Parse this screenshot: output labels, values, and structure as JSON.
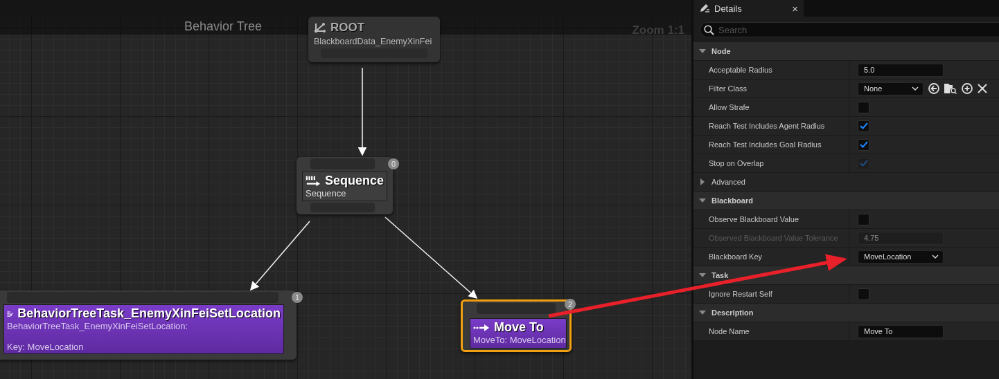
{
  "graph": {
    "title": "Behavior Tree",
    "zoom": "Zoom 1:1",
    "nodes": [
      {
        "kind": "root",
        "title": "ROOT",
        "subtitle": "BlackboardData_EnemyXinFei"
      },
      {
        "kind": "composite",
        "title": "Sequence",
        "subtitle": "Sequence",
        "index": "0",
        "selected": false
      },
      {
        "kind": "task",
        "title": "BehaviorTreeTask_EnemyXinFeiSetLocation",
        "subtitle": "BehaviorTreeTask_EnemyXinFeiSetLocation:\n\nKey: MoveLocation",
        "index": "1",
        "selected": false
      },
      {
        "kind": "task",
        "title": "Move To",
        "subtitle": "MoveTo: MoveLocation",
        "index": "2",
        "selected": true
      }
    ]
  },
  "details": {
    "tab": "Details",
    "close": "×",
    "search": {
      "placeholder": "Search"
    },
    "sections": [
      {
        "title": "Node",
        "expanded": true,
        "rows": [
          {
            "kind": "text",
            "label": "Acceptable Radius",
            "value": "5.0",
            "disabled": false
          },
          {
            "kind": "class",
            "label": "Filter Class",
            "value": "None",
            "disabled": false
          },
          {
            "kind": "checkbox",
            "label": "Allow Strafe",
            "checked": false,
            "disabled": false
          },
          {
            "kind": "checkbox",
            "label": "Reach Test Includes Agent Radius",
            "checked": true,
            "disabled": false
          },
          {
            "kind": "checkbox",
            "label": "Reach Test Includes Goal Radius",
            "checked": true,
            "disabled": false
          },
          {
            "kind": "checkbox",
            "label": "Stop on Overlap",
            "checked": true,
            "disabled": true
          }
        ]
      },
      {
        "title": "Advanced",
        "expanded": false
      },
      {
        "title": "Blackboard",
        "expanded": true,
        "rows": [
          {
            "kind": "checkbox",
            "label": "Observe Blackboard Value",
            "checked": false,
            "disabled": false
          },
          {
            "kind": "text",
            "label": "Observed Blackboard Value Tolerance",
            "value": "4.75",
            "disabled": true
          },
          {
            "kind": "combo",
            "label": "Blackboard Key",
            "value": "MoveLocation",
            "disabled": false
          }
        ]
      },
      {
        "title": "Task",
        "expanded": true,
        "rows": [
          {
            "kind": "checkbox",
            "label": "Ignore Restart Self",
            "checked": false,
            "disabled": false
          }
        ]
      },
      {
        "title": "Description",
        "expanded": true,
        "rows": [
          {
            "kind": "text",
            "label": "Node Name",
            "value": "Move To",
            "disabled": false
          }
        ]
      }
    ]
  }
}
